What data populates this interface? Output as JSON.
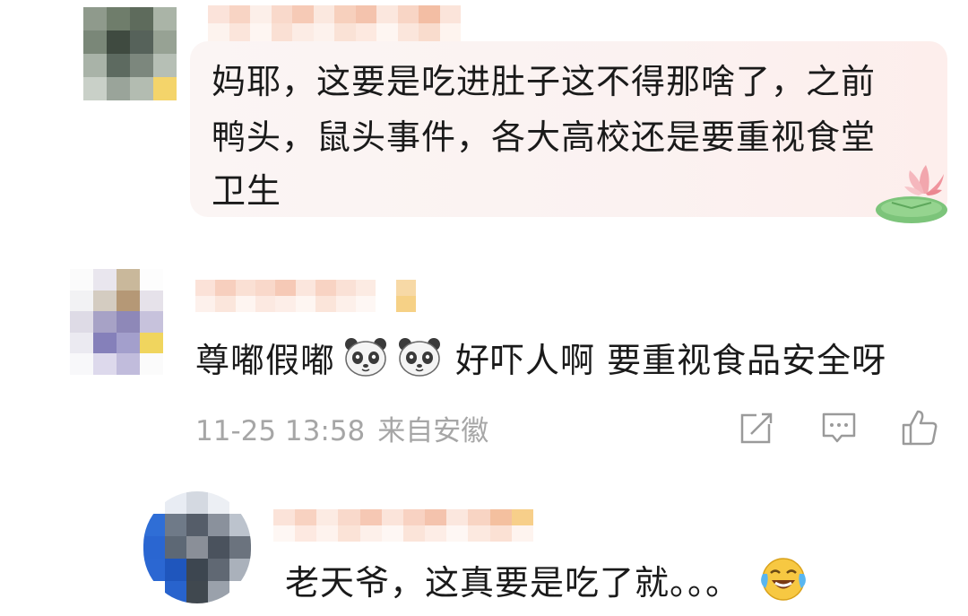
{
  "comments": [
    {
      "username": "",
      "text_lines": [
        "妈耶，这要是吃进肚子这不得那啥了，之前",
        "鸭头，鼠头事件，各大高校还是要重视食堂",
        "卫生"
      ]
    },
    {
      "username": "",
      "text_part1": "尊嘟假嘟",
      "text_part2": "好吓人啊 要重视食品安全呀",
      "emoji_names": [
        "panda-face-icon",
        "panda-face-icon"
      ],
      "timestamp": "11-25 13:58",
      "location": "来自安徽",
      "actions": {
        "share_icon": "share-edit-icon",
        "reply_icon": "comment-icon",
        "like_icon": "thumbs-up-icon"
      }
    },
    {
      "username": "",
      "text": "老天爷，这真要是吃了就。。。",
      "emoji_name": "laughing-crying-icon"
    }
  ],
  "colors": {
    "text": "#1a1a1a",
    "meta": "#a6a6a6",
    "bubble": "#fbf3f2",
    "icon": "#9a9a9a"
  }
}
